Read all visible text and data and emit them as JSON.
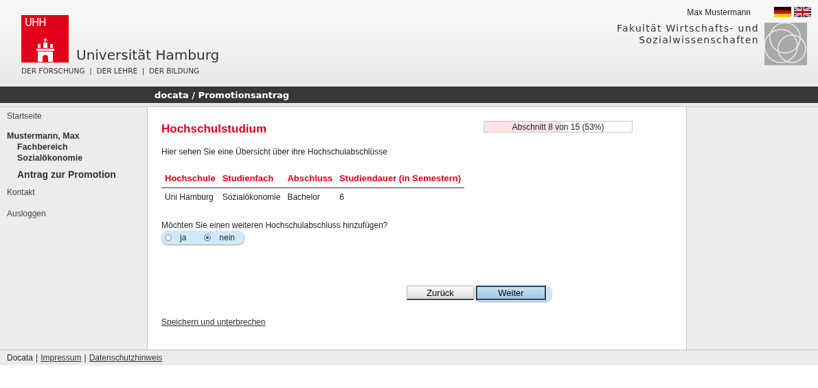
{
  "header": {
    "logo_mark": "UHH",
    "university": "Universität Hamburg",
    "tagline": "DER FORSCHUNG  |  DER LEHRE  |  DER BILDUNG",
    "user": "Max Mustermann",
    "faculty": [
      "Fakultät Wirtschafts- und",
      "Sozialwissenschaften"
    ]
  },
  "title_bar": "docata / Promotionsantrag",
  "sidebar": {
    "items": [
      {
        "kind": "link",
        "label": "Startseite"
      },
      {
        "kind": "name",
        "label": "Mustermann, Max"
      },
      {
        "kind": "sub",
        "label": "Fachbereich"
      },
      {
        "kind": "sub",
        "label": "Sozialökonomie"
      },
      {
        "kind": "section",
        "label": "Antrag zur Promotion"
      },
      {
        "kind": "link",
        "label": "Kontakt"
      },
      {
        "kind": "link",
        "label": "Ausloggen"
      }
    ]
  },
  "main": {
    "heading": "Hochschulstudium",
    "progress": {
      "label": "Abschnitt 8 von 15 (53%)",
      "level": 0.53
    },
    "intro": "Hier sehen Sie eine Übersicht über ihre Hochschulabschlüsse",
    "table": {
      "columns": [
        "Hochschule",
        "Studienfach",
        "Abschluss",
        "Studiendauer (in Semestern)"
      ],
      "rows": [
        [
          "Uni Hamburg",
          "Sozialökonomie",
          "Bachelor",
          "6"
        ]
      ]
    },
    "question": "Möchten Sie einen weiteren Hochschulabschluss hinzufügen?",
    "options": [
      {
        "label": "ja",
        "selected": false
      },
      {
        "label": "nein",
        "selected": true
      }
    ],
    "buttons": [
      {
        "kind": "secondary",
        "label": "Zurück"
      },
      {
        "kind": "primary",
        "label": "Weiter"
      }
    ],
    "save_link": "Speichern und unterbrechen"
  },
  "footer": [
    {
      "kind": "text",
      "label": "Docata"
    },
    {
      "kind": "sep",
      "label": "|"
    },
    {
      "kind": "link",
      "label": "Impressum"
    },
    {
      "kind": "sep",
      "label": "|"
    },
    {
      "kind": "link",
      "label": "Datenschutzhinweis"
    }
  ]
}
